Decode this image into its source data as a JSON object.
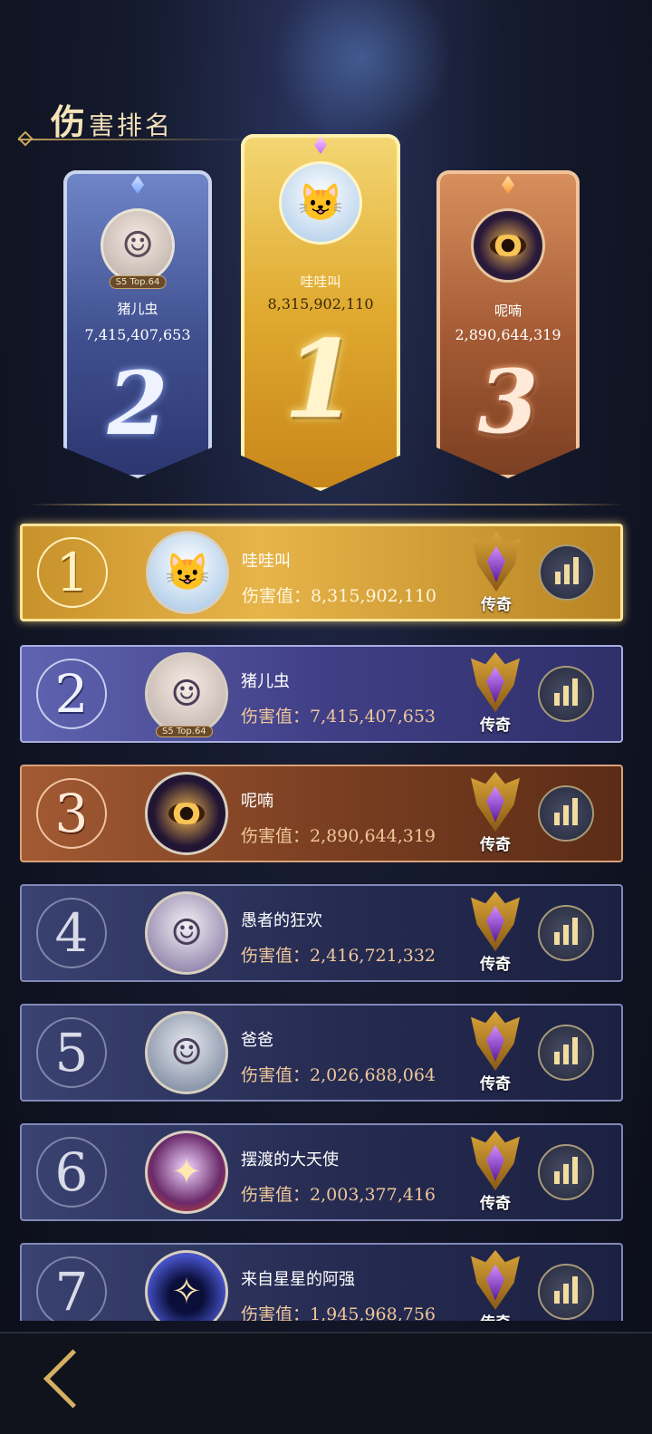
{
  "title": {
    "first_char": "伤",
    "rest": "害排名"
  },
  "podium": [
    {
      "rank": "2",
      "name": "猪儿虫",
      "value": "7,415,407,653",
      "tag": "S5 Top.64"
    },
    {
      "rank": "1",
      "name": "哇哇叫",
      "value": "8,315,902,110"
    },
    {
      "rank": "3",
      "name": "呢喃",
      "value": "2,890,644,319"
    }
  ],
  "rows": [
    {
      "rank": "1",
      "name": "哇哇叫",
      "damage_label": "伤害值：",
      "damage": "8,315,902,110",
      "badge": "传奇",
      "avatar": "cat-avatar"
    },
    {
      "rank": "2",
      "name": "猪儿虫",
      "damage_label": "伤害值：",
      "damage": "7,415,407,653",
      "badge": "传奇",
      "tag": "S5 Top.64",
      "avatar": "girl-avatar"
    },
    {
      "rank": "3",
      "name": "呢喃",
      "damage_label": "伤害值：",
      "damage": "2,890,644,319",
      "badge": "传奇",
      "avatar": "eye-avatar"
    },
    {
      "rank": "4",
      "name": "愚者的狂欢",
      "damage_label": "伤害值：",
      "damage": "2,416,721,332",
      "badge": "传奇",
      "avatar": "silver-hair-avatar"
    },
    {
      "rank": "5",
      "name": "爸爸",
      "damage_label": "伤害值：",
      "damage": "2,026,688,064",
      "badge": "传奇",
      "avatar": "white-hair-man-avatar"
    },
    {
      "rank": "6",
      "name": "摆渡的大天使",
      "damage_label": "伤害值：",
      "damage": "2,003,377,416",
      "badge": "传奇",
      "avatar": "archangel-avatar"
    },
    {
      "rank": "7",
      "name": "来自星星的阿强",
      "damage_label": "伤害值：",
      "damage": "1,945,968,756",
      "badge": "传奇",
      "avatar": "hooded-avatar"
    }
  ],
  "icons": {
    "stats": "bar-chart-icon",
    "badge": "legend-rank-emblem-icon",
    "back": "back-arrow-icon"
  },
  "colors": {
    "gold": "#e7b44a",
    "silver": "#5f63b0",
    "bronze": "#a25a33",
    "default_row": "#262c52",
    "damage_text": "#f0c79a"
  }
}
